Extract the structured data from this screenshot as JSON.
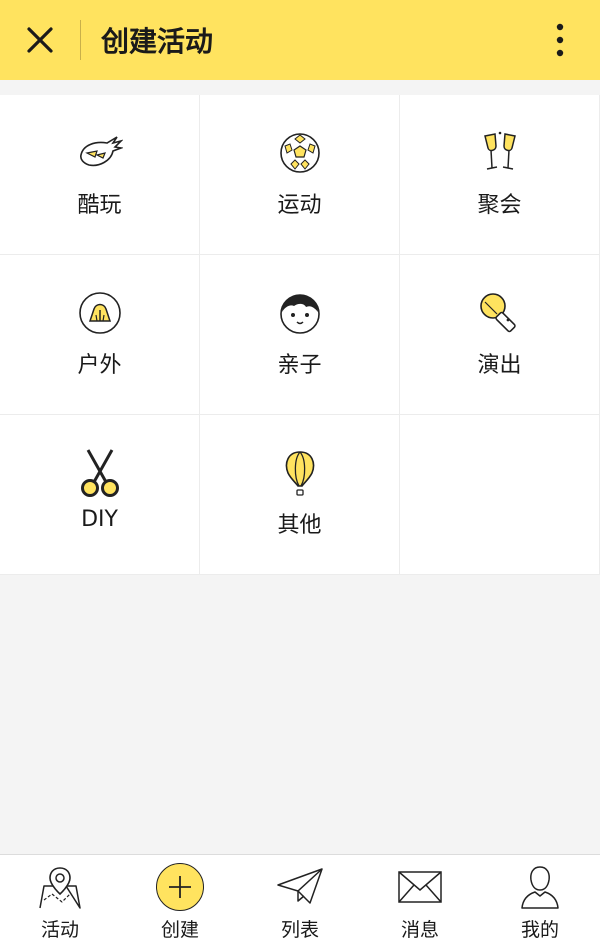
{
  "header": {
    "title": "创建活动",
    "close_icon": "close-icon",
    "more_icon": "more-vertical-icon",
    "background": "#ffe35f"
  },
  "categories": [
    {
      "label": "酷玩",
      "icon": "eagle-icon"
    },
    {
      "label": "运动",
      "icon": "soccer-ball-icon"
    },
    {
      "label": "聚会",
      "icon": "champagne-glasses-icon"
    },
    {
      "label": "户外",
      "icon": "tent-icon"
    },
    {
      "label": "亲子",
      "icon": "kid-face-icon"
    },
    {
      "label": "演出",
      "icon": "microphone-icon"
    },
    {
      "label": "DIY",
      "icon": "scissors-icon"
    },
    {
      "label": "其他",
      "icon": "hot-air-balloon-icon"
    }
  ],
  "tabbar": {
    "items": [
      {
        "label": "活动",
        "icon": "map-pin-icon"
      },
      {
        "label": "创建",
        "icon": "plus-circle-icon"
      },
      {
        "label": "列表",
        "icon": "paper-plane-icon"
      },
      {
        "label": "消息",
        "icon": "envelope-icon"
      },
      {
        "label": "我的",
        "icon": "user-icon"
      }
    ]
  },
  "colors": {
    "accent": "#ffe35f",
    "text": "#1a1a1a",
    "background": "#f4f4f4"
  }
}
